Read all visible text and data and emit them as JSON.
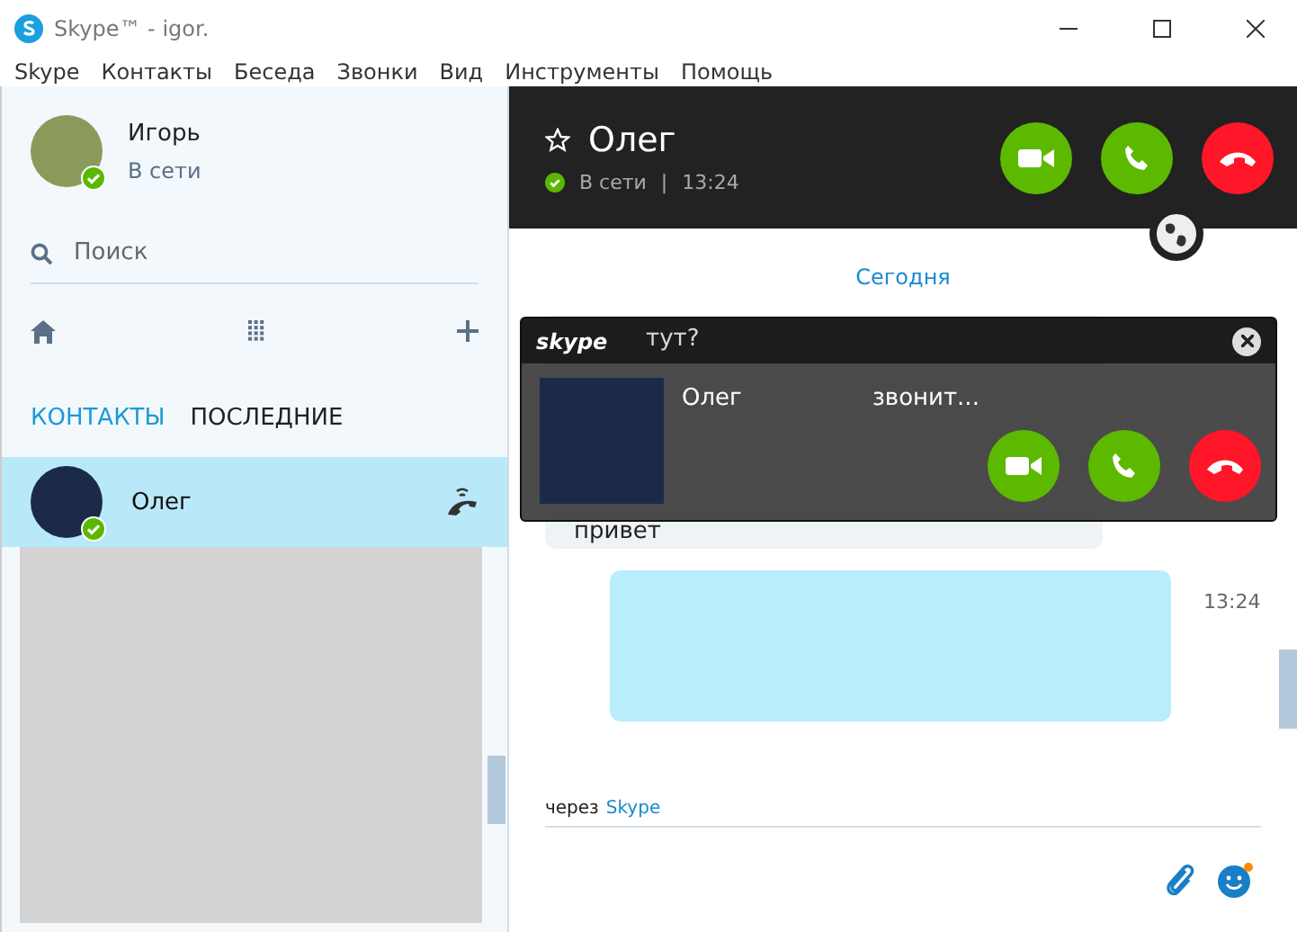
{
  "window": {
    "title": "Skype™ - igor."
  },
  "menu": [
    "Skype",
    "Контакты",
    "Беседа",
    "Звонки",
    "Вид",
    "Инструменты",
    "Помощь"
  ],
  "profile": {
    "name": "Игорь",
    "status": "В сети"
  },
  "search": {
    "placeholder": "Поиск"
  },
  "tabs": [
    {
      "label": "КОНТАКТЫ",
      "selected": true
    },
    {
      "label": "ПОСЛЕДНИЕ",
      "selected": false
    }
  ],
  "contacts": [
    {
      "name": "Олег",
      "selected": true
    }
  ],
  "chat": {
    "name": "Олег",
    "status": "В сети",
    "separator": "|",
    "time": "13:24",
    "day": "Сегодня",
    "messages": [
      {
        "kind": "incoming",
        "lines": [
          "тут?",
          "привет"
        ]
      },
      {
        "kind": "outgoing",
        "time": "13:24"
      }
    ],
    "via": {
      "prefix": "через",
      "link": "Skype"
    }
  },
  "incoming_call": {
    "brand": "skype",
    "name": "Олег",
    "status": "звонит..."
  }
}
